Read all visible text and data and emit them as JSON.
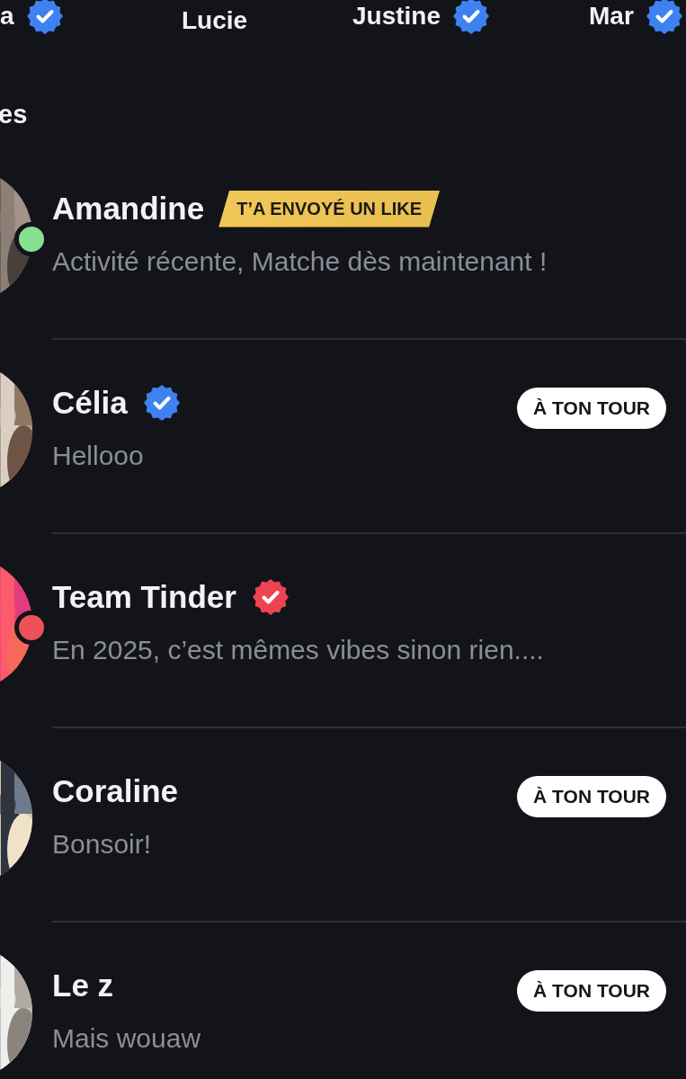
{
  "top_matches": [
    {
      "name": "a",
      "verified": true
    },
    {
      "name": "Lucie",
      "verified": false
    },
    {
      "name": "Justine",
      "verified": true
    },
    {
      "name": "Mar",
      "verified": true
    }
  ],
  "section_title": "es",
  "conversations": [
    {
      "name": "Amandine",
      "verified": false,
      "tag": "T’A ENVOYÉ UN LIKE",
      "status": {
        "color": "#86e08f"
      },
      "message": "Activité récente, Matche dès maintenant !"
    },
    {
      "name": "Célia",
      "verified": true,
      "badge": {
        "color": "#3d82f0"
      },
      "action": "À TON TOUR",
      "message": "Hellooo"
    },
    {
      "name": "Team Tinder",
      "verified": true,
      "badge": {
        "color": "#ee4452"
      },
      "status": {
        "color": "#ee5157"
      },
      "message": "En 2025, c’est mêmes vibes sinon rien...."
    },
    {
      "name": "Coraline",
      "verified": false,
      "action": "À TON TOUR",
      "message": "Bonsoir!"
    },
    {
      "name": "Le z",
      "verified": false,
      "action": "À TON TOUR",
      "message": "Mais wouaw"
    }
  ]
}
